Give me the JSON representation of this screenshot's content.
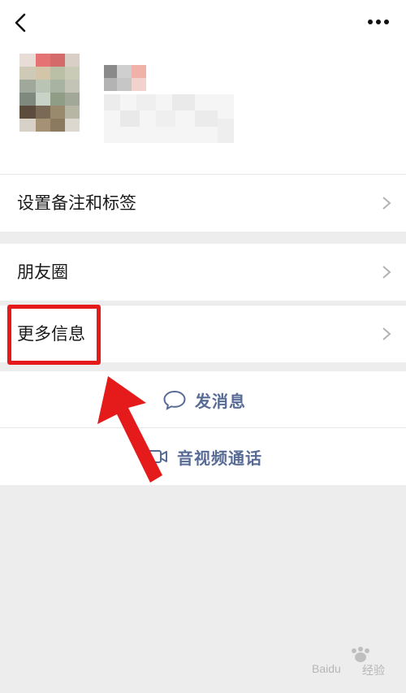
{
  "header": {
    "back_icon": "chevron-left-icon",
    "more_icon": "more-dots-icon"
  },
  "rows": {
    "remark": {
      "label": "设置备注和标签"
    },
    "moments": {
      "label": "朋友圈"
    },
    "more_info": {
      "label": "更多信息"
    }
  },
  "actions": {
    "message": {
      "label": "发消息",
      "icon": "chat-bubble-icon"
    },
    "call": {
      "label": "音视频通话",
      "icon": "video-camera-icon"
    }
  },
  "colors": {
    "accent": "#576b95",
    "annotation": "#e51b1b",
    "background": "#ededed"
  },
  "watermark": {
    "text": "Baidu",
    "text2": "经验"
  }
}
